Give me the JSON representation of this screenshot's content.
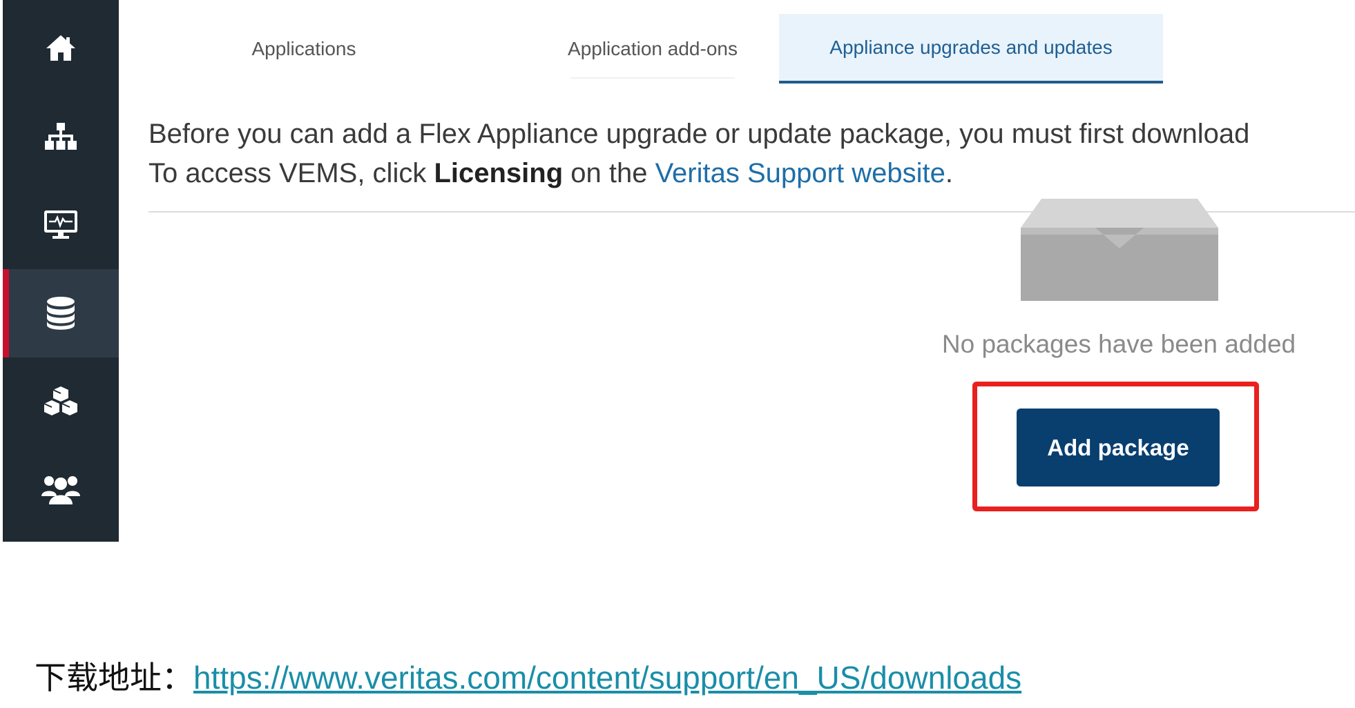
{
  "sidebar": {
    "items": [
      {
        "icon": "home-icon"
      },
      {
        "icon": "hierarchy-icon"
      },
      {
        "icon": "monitor-icon"
      },
      {
        "icon": "database-icon",
        "active": true
      },
      {
        "icon": "cubes-icon"
      },
      {
        "icon": "users-icon"
      }
    ]
  },
  "tabs": [
    {
      "label": "Applications"
    },
    {
      "label": "Application add-ons"
    },
    {
      "label": "Appliance upgrades and updates",
      "active": true
    }
  ],
  "description": {
    "line1": "Before you can add a Flex Appliance upgrade or update package, you must first download",
    "line2_prefix": "To access VEMS, click ",
    "line2_bold": "Licensing",
    "line2_middle": " on the ",
    "line2_link": "Veritas Support website",
    "line2_suffix": "."
  },
  "empty_state": {
    "icon": "empty-tray-icon",
    "message": "No packages have been added",
    "button_label": "Add package"
  },
  "download": {
    "label": "下载地址：",
    "url": "https://www.veritas.com/content/support/en_US/downloads"
  },
  "colors": {
    "sidebar_bg": "#1f2a33",
    "active_indicator": "#c8102e",
    "tab_active_text": "#1f5f93",
    "button_bg": "#083f6f",
    "highlight": "#e8201e",
    "link": "#1e6ea7"
  }
}
